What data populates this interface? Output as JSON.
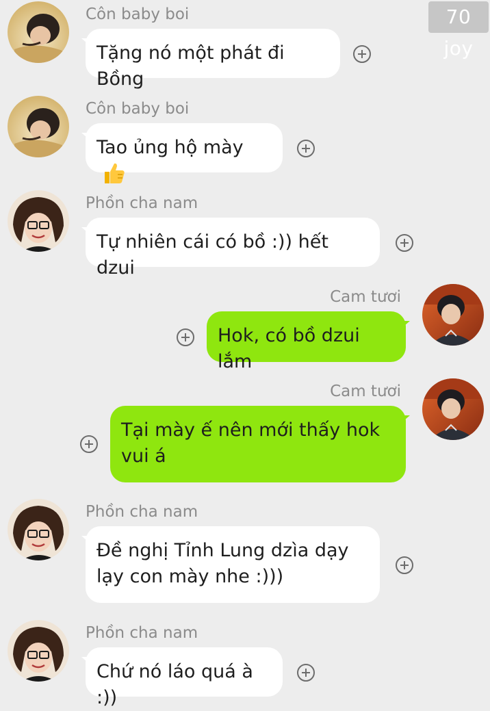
{
  "watermark": "70 joy",
  "messages": [
    {
      "sender": "Côn baby boi",
      "text": "Tặng nó một phát đi Bồng",
      "side": "in"
    },
    {
      "sender": "Côn baby boi",
      "text": "Tao ủng hộ mày",
      "side": "in",
      "emoji": "thumbs-up-emoji"
    },
    {
      "sender": "Phồn cha nam",
      "text": "Tự nhiên cái có bồ :)) hết dzui",
      "side": "in"
    },
    {
      "sender": "Cam tươi",
      "text": "Hok, có bồ dzui lắm",
      "side": "out"
    },
    {
      "sender": "Cam tươi",
      "text": "Tại mày ế nên mới thấy hok vui á",
      "side": "out"
    },
    {
      "sender": "Phồn cha nam",
      "text": "Đề nghị Tỉnh Lung dzìa dạy lạy con mày nhe :)))",
      "side": "in"
    },
    {
      "sender": "Phồn cha nam",
      "text": "Chứ nó láo quá à :))",
      "side": "in"
    }
  ],
  "colors": {
    "background": "#ededed",
    "incoming_bubble": "#ffffff",
    "outgoing_bubble": "#8fe60f",
    "sender_name": "#8b8b8b"
  }
}
